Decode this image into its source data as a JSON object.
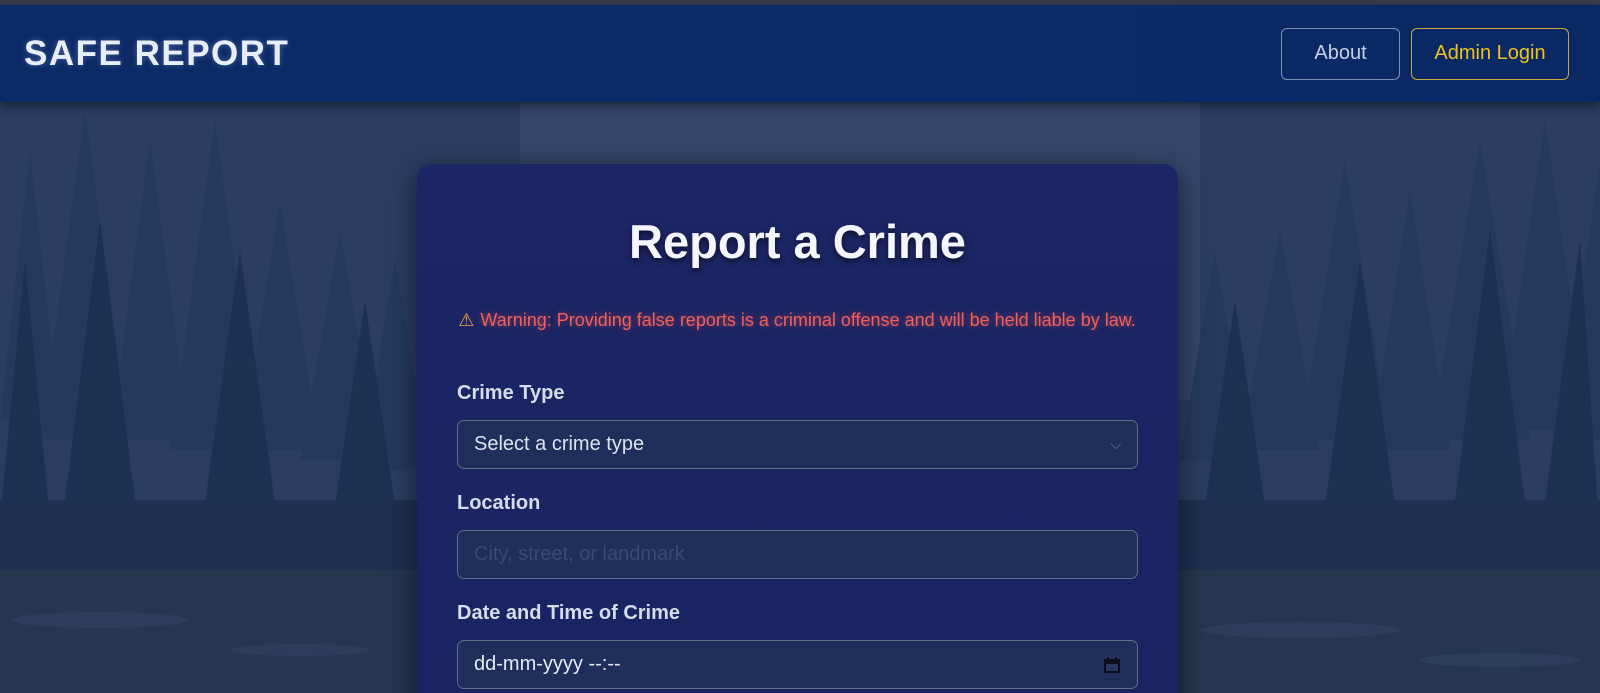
{
  "header": {
    "brand": "SAFE REPORT",
    "about_label": "About",
    "admin_login_label": "Admin Login"
  },
  "form": {
    "title": "Report a Crime",
    "warning_icon": "⚠",
    "warning_text": "Warning: Providing false reports is a criminal offense and will be held liable by law.",
    "crime_type": {
      "label": "Crime Type",
      "selected": "Select a crime type"
    },
    "location": {
      "label": "Location",
      "placeholder": "City, street, or landmark",
      "value": ""
    },
    "datetime": {
      "label": "Date and Time of Crime",
      "value": "dd-mm-yyyy --:--"
    }
  },
  "colors": {
    "navbar": "#0b2a67",
    "card": "#1c2664",
    "warning": "#f0605a",
    "admin_accent": "#f1c21f"
  }
}
